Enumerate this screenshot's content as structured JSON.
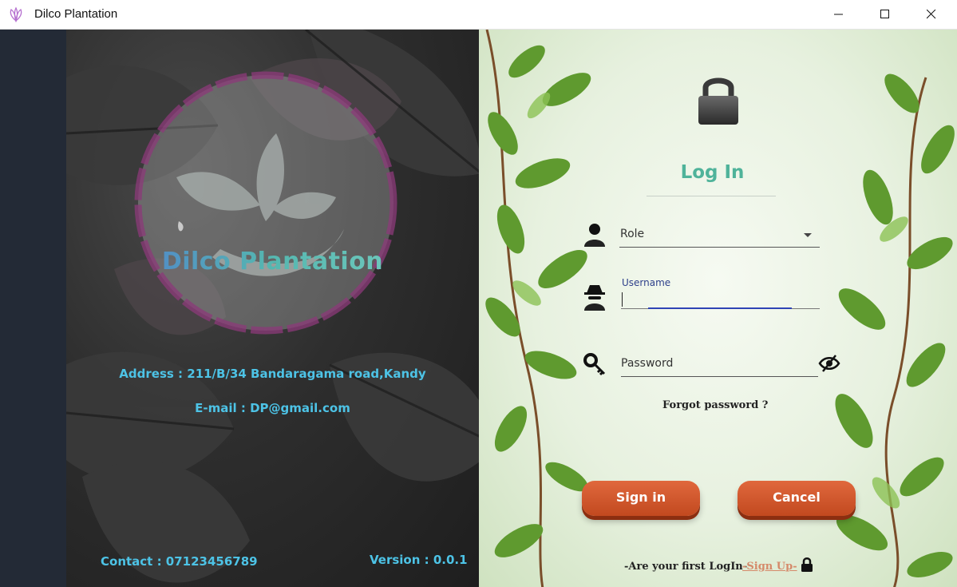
{
  "window": {
    "title": "Dilco Plantation"
  },
  "left": {
    "brand": "Dilco Plantation",
    "address": "Address : 211/B/34 Bandaragama road,Kandy",
    "email": "E-mail : DP@gmail.com",
    "contact": "Contact : 07123456789",
    "version": "Version : 0.0.1"
  },
  "login": {
    "title": "Log In",
    "role_label": "Role",
    "username_label": "Username",
    "username_value": "",
    "password_label": "Password",
    "forgot": "Forgot password ?",
    "signin": "Sign in",
    "cancel": "Cancel",
    "first_login": "-Are your first LogIn-",
    "signup": "-Sign Up-"
  },
  "colors": {
    "accent_teal": "#4fb39a",
    "info_blue": "#4dc3e6",
    "button_orange": "#d4582c",
    "strip": "#232a36"
  },
  "icons": [
    "app-icon",
    "minimize-icon",
    "maximize-icon",
    "close-icon",
    "lock-icon",
    "user-icon",
    "spy-icon",
    "key-icon",
    "eye-slash-icon",
    "padlock-small-icon"
  ]
}
